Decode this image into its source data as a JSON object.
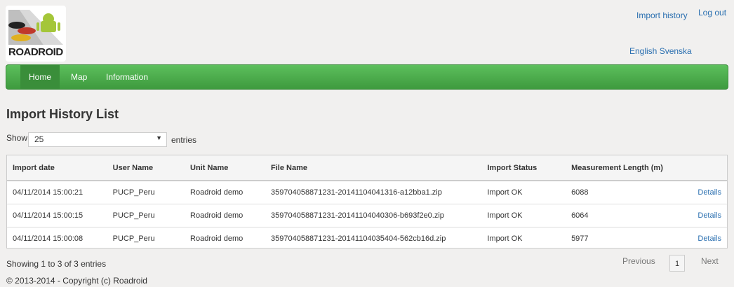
{
  "brand": {
    "logo_text": "ROADROID"
  },
  "top_links": {
    "import_history": "Import history",
    "logout": "Log out"
  },
  "languages": {
    "english": "English",
    "svenska": "Svenska"
  },
  "nav": {
    "items": [
      "Home",
      "Map",
      "Information"
    ],
    "active": "Home"
  },
  "page": {
    "title": "Import History List"
  },
  "length_control": {
    "show_label": "Show",
    "value": "25",
    "entries_label": "entries"
  },
  "table": {
    "headers": [
      "Import date",
      "User Name",
      "Unit Name",
      "File Name",
      "Import Status",
      "Measurement Length (m)",
      ""
    ],
    "rows": [
      [
        "04/11/2014 15:00:21",
        "PUCP_Peru",
        "Roadroid demo",
        "359704058871231-20141104041316-a12bba1.zip",
        "Import OK",
        "6088",
        "Details"
      ],
      [
        "04/11/2014 15:00:15",
        "PUCP_Peru",
        "Roadroid demo",
        "359704058871231-20141104040306-b693f2e0.zip",
        "Import OK",
        "6064",
        "Details"
      ],
      [
        "04/11/2014 15:00:08",
        "PUCP_Peru",
        "Roadroid demo",
        "359704058871231-20141104035404-562cb16d.zip",
        "Import OK",
        "5977",
        "Details"
      ]
    ]
  },
  "pagination": {
    "info": "Showing 1 to 3 of 3 entries",
    "previous": "Previous",
    "current": "1",
    "next": "Next"
  },
  "footer": {
    "copyright": "© 2013-2014 - Copyright (c) Roadroid"
  },
  "colors": {
    "navbar": "#4cae4c",
    "link": "#2a6fb0",
    "background": "#f1f0ef"
  }
}
